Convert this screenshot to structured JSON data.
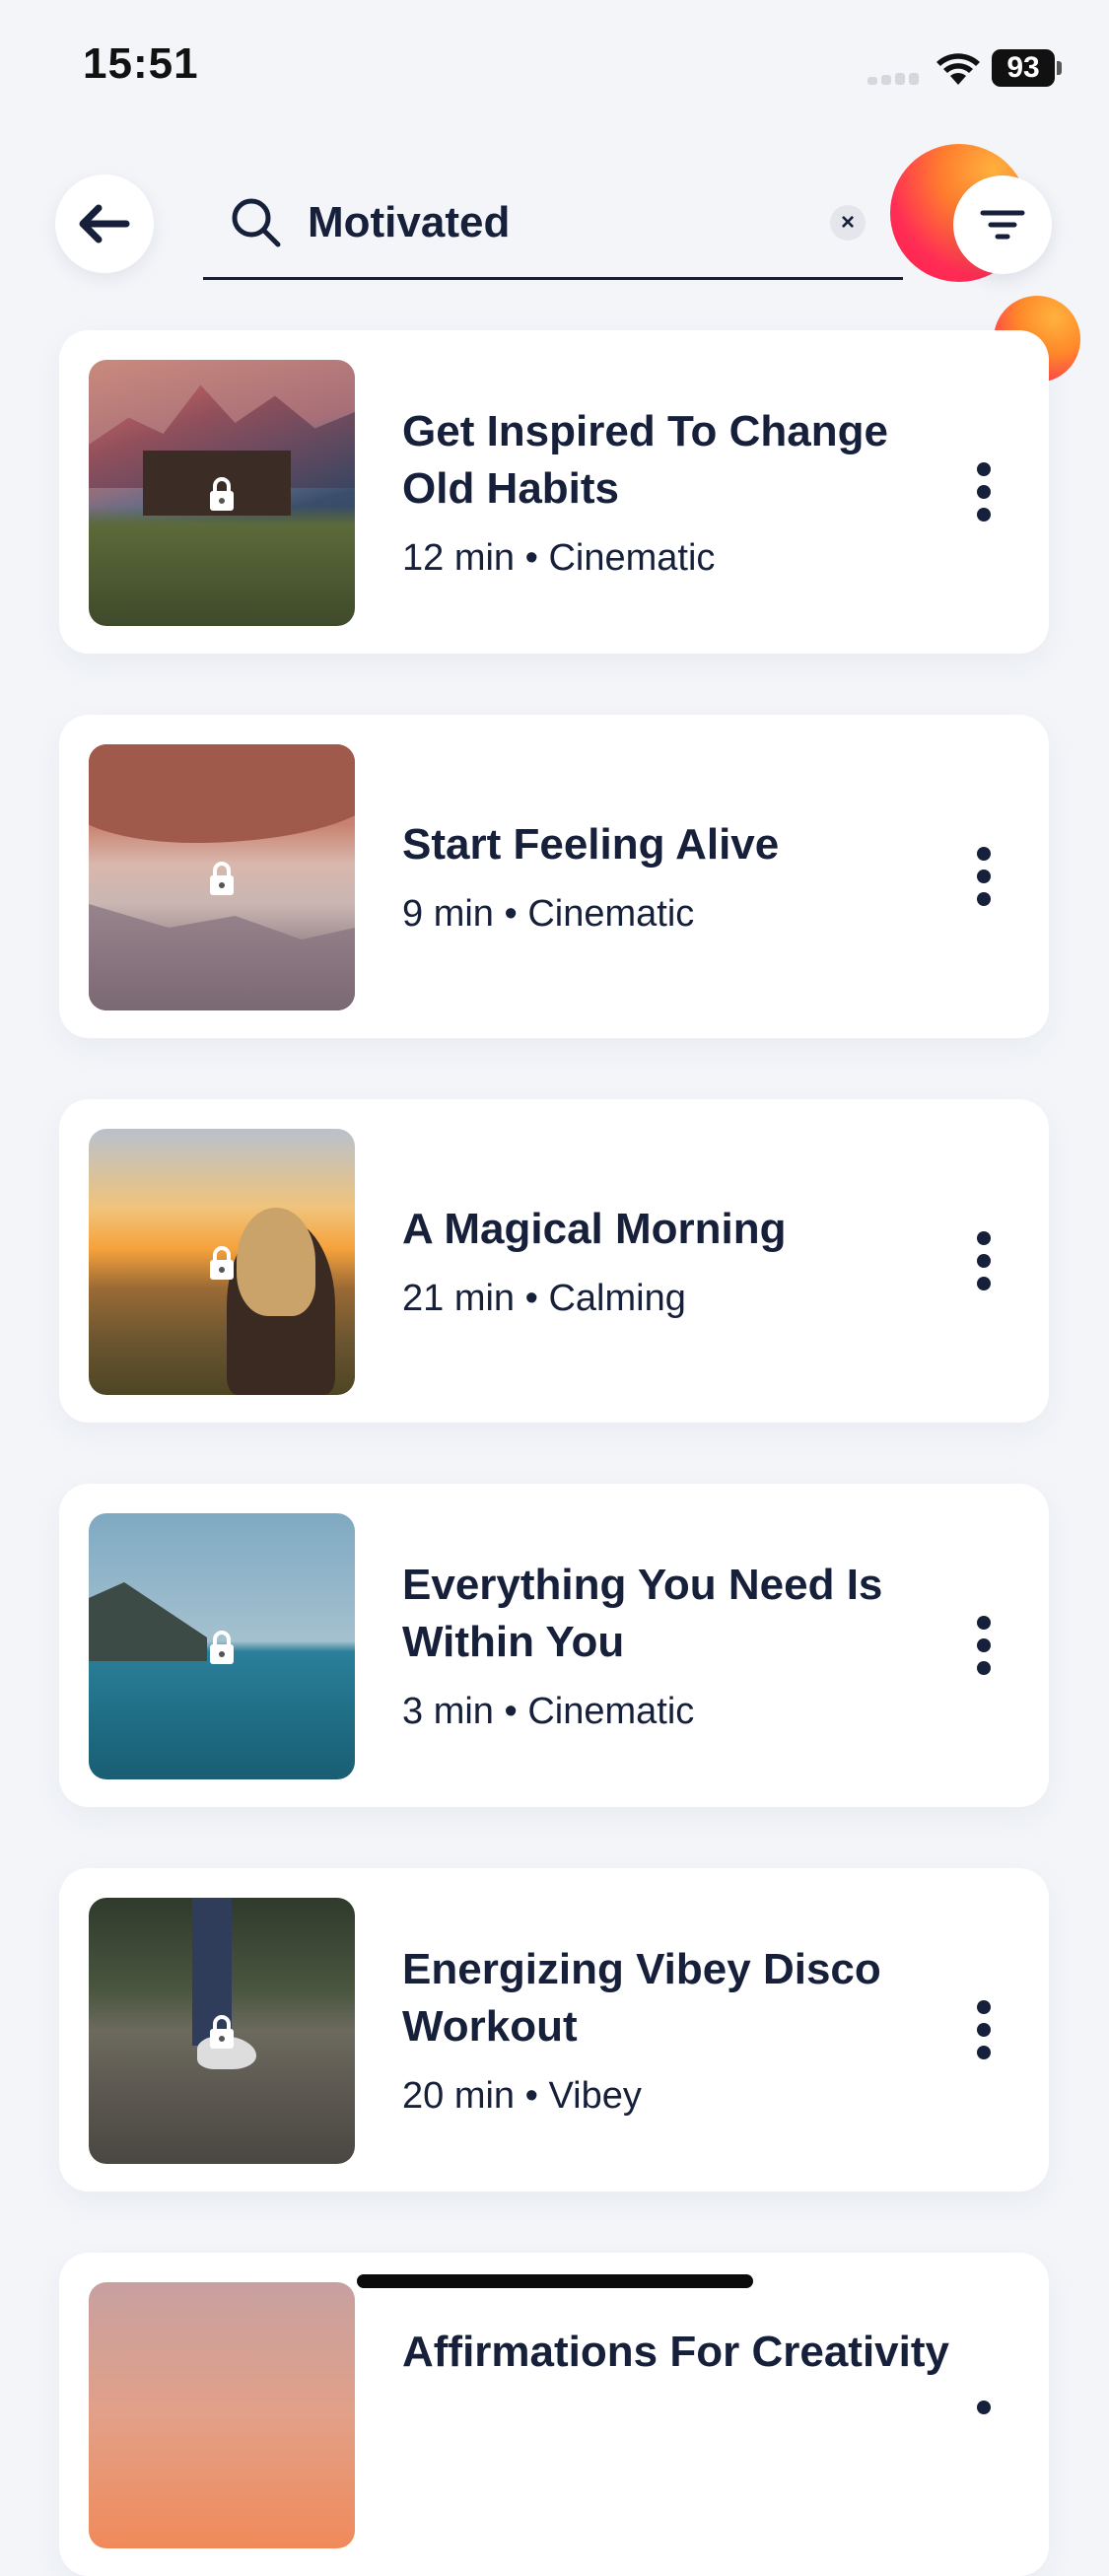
{
  "status_bar": {
    "time": "15:51",
    "battery": "93"
  },
  "search": {
    "query": "Motivated",
    "clear_symbol": "×"
  },
  "icons": {
    "back": "arrow-left-icon",
    "search": "search-icon",
    "filter": "filter-icon",
    "lock": "lock-icon",
    "more": "more-vertical-icon"
  },
  "colors": {
    "background": "#f3f5f9",
    "text": "#17203a",
    "accent_orange": "#ff8a2a",
    "accent_red": "#ff2d55"
  },
  "results": [
    {
      "title": "Get Inspired To Change Old Habits",
      "meta": "12 min • Cinematic",
      "locked": true
    },
    {
      "title": "Start Feeling Alive",
      "meta": "9 min • Cinematic",
      "locked": true
    },
    {
      "title": "A Magical Morning",
      "meta": "21 min • Calming",
      "locked": true
    },
    {
      "title": "Everything You Need Is Within You",
      "meta": "3 min • Cinematic",
      "locked": true
    },
    {
      "title": "Energizing Vibey Disco Workout",
      "meta": "20 min • Vibey",
      "locked": true
    },
    {
      "title": "Affirmations For Creativity",
      "meta": "",
      "locked": true
    }
  ]
}
